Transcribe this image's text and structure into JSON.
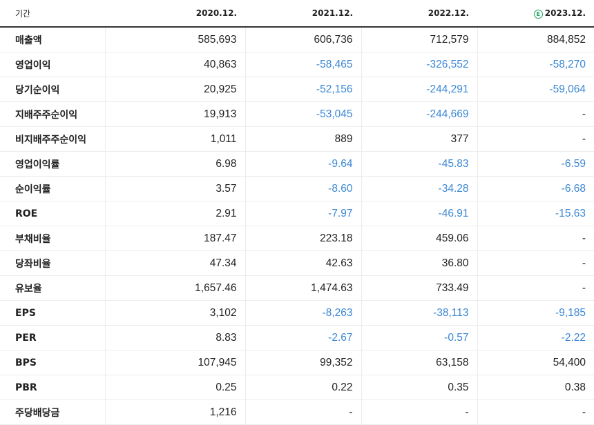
{
  "header": {
    "label": "기간",
    "years": [
      "2020.12.",
      "2021.12.",
      "2022.12.",
      "2023.12."
    ],
    "estimate_badge": "E"
  },
  "colors": {
    "negative": "#3b87d4",
    "estimate": "#1aa35a"
  },
  "rows": [
    {
      "label": "매출액",
      "values": [
        "585,693",
        "606,736",
        "712,579",
        "884,852"
      ]
    },
    {
      "label": "영업이익",
      "values": [
        "40,863",
        "-58,465",
        "-326,552",
        "-58,270"
      ]
    },
    {
      "label": "당기순이익",
      "values": [
        "20,925",
        "-52,156",
        "-244,291",
        "-59,064"
      ]
    },
    {
      "label": "지배주주순이익",
      "values": [
        "19,913",
        "-53,045",
        "-244,669",
        "-"
      ]
    },
    {
      "label": "비지배주주순이익",
      "values": [
        "1,011",
        "889",
        "377",
        "-"
      ]
    },
    {
      "label": "영업이익률",
      "values": [
        "6.98",
        "-9.64",
        "-45.83",
        "-6.59"
      ]
    },
    {
      "label": "순이익률",
      "values": [
        "3.57",
        "-8.60",
        "-34.28",
        "-6.68"
      ]
    },
    {
      "label": "ROE",
      "values": [
        "2.91",
        "-7.97",
        "-46.91",
        "-15.63"
      ]
    },
    {
      "label": "부채비율",
      "values": [
        "187.47",
        "223.18",
        "459.06",
        "-"
      ]
    },
    {
      "label": "당좌비율",
      "values": [
        "47.34",
        "42.63",
        "36.80",
        "-"
      ]
    },
    {
      "label": "유보율",
      "values": [
        "1,657.46",
        "1,474.63",
        "733.49",
        "-"
      ]
    },
    {
      "label": "EPS",
      "values": [
        "3,102",
        "-8,263",
        "-38,113",
        "-9,185"
      ]
    },
    {
      "label": "PER",
      "values": [
        "8.83",
        "-2.67",
        "-0.57",
        "-2.22"
      ]
    },
    {
      "label": "BPS",
      "values": [
        "107,945",
        "99,352",
        "63,158",
        "54,400"
      ]
    },
    {
      "label": "PBR",
      "values": [
        "0.25",
        "0.22",
        "0.35",
        "0.38"
      ]
    },
    {
      "label": "주당배당금",
      "values": [
        "1,216",
        "-",
        "-",
        "-"
      ]
    }
  ]
}
